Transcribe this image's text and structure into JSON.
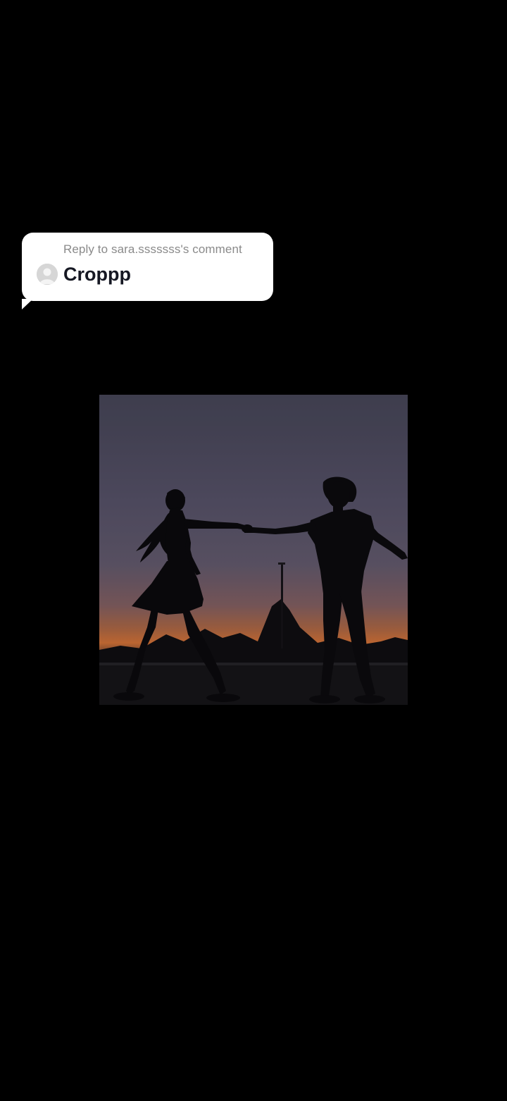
{
  "reply": {
    "header": "Reply to sara.sssssss's comment",
    "text": "Croppp",
    "avatar_icon": "default-user-avatar-icon"
  },
  "video": {
    "scene": "silhouette-couple-dancing-at-sunset",
    "colors": {
      "sky_top": "#474658",
      "sky_mid": "#5a5468",
      "sky_low": "#8a5c4e",
      "horizon": "#c06a3a",
      "silhouette": "#0b0a0d",
      "ground": "#141316"
    }
  },
  "background_color": "#000000"
}
